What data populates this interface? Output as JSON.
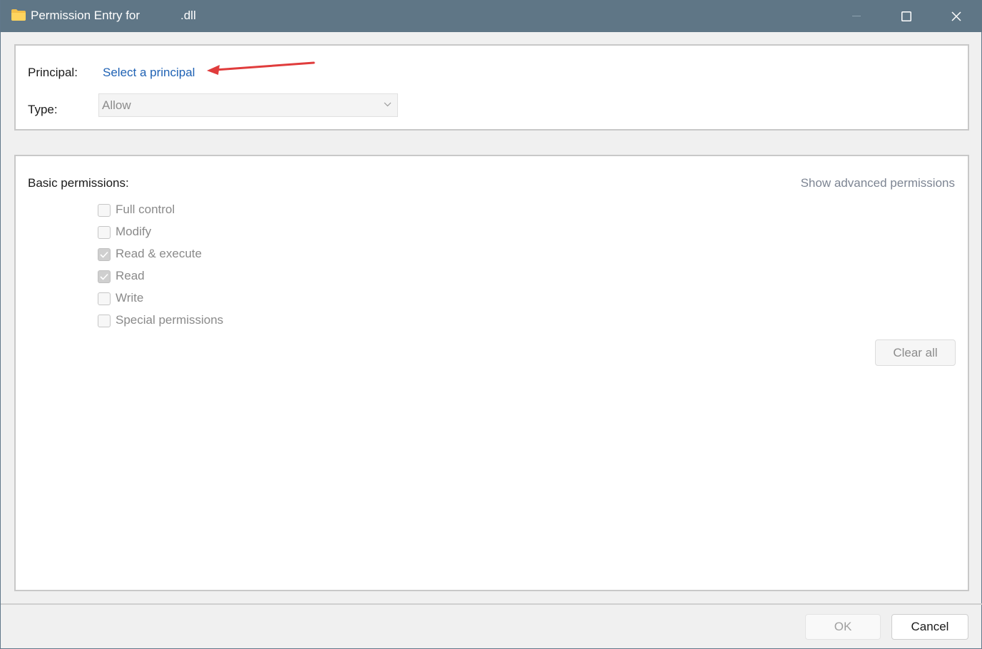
{
  "window": {
    "title_prefix": "Permission Entry for",
    "title_suffix": ".dll",
    "icon": "folder-icon",
    "controls": [
      "minimize-icon",
      "maximize-icon",
      "close-icon"
    ]
  },
  "principal_section": {
    "principal_label": "Principal:",
    "principal_link": "Select a principal",
    "type_label": "Type:",
    "type_value": "Allow"
  },
  "permissions_section": {
    "heading": "Basic permissions:",
    "advanced_link": "Show advanced permissions",
    "items": [
      {
        "label": "Full control",
        "checked": false
      },
      {
        "label": "Modify",
        "checked": false
      },
      {
        "label": "Read & execute",
        "checked": true
      },
      {
        "label": "Read",
        "checked": true
      },
      {
        "label": "Write",
        "checked": false
      },
      {
        "label": "Special permissions",
        "checked": false
      }
    ],
    "clear_all_label": "Clear all"
  },
  "footer": {
    "ok_label": "OK",
    "cancel_label": "Cancel"
  },
  "colors": {
    "titlebar": "#5f7686",
    "link": "#1f62b4",
    "annotation_arrow": "#e03c3c"
  }
}
